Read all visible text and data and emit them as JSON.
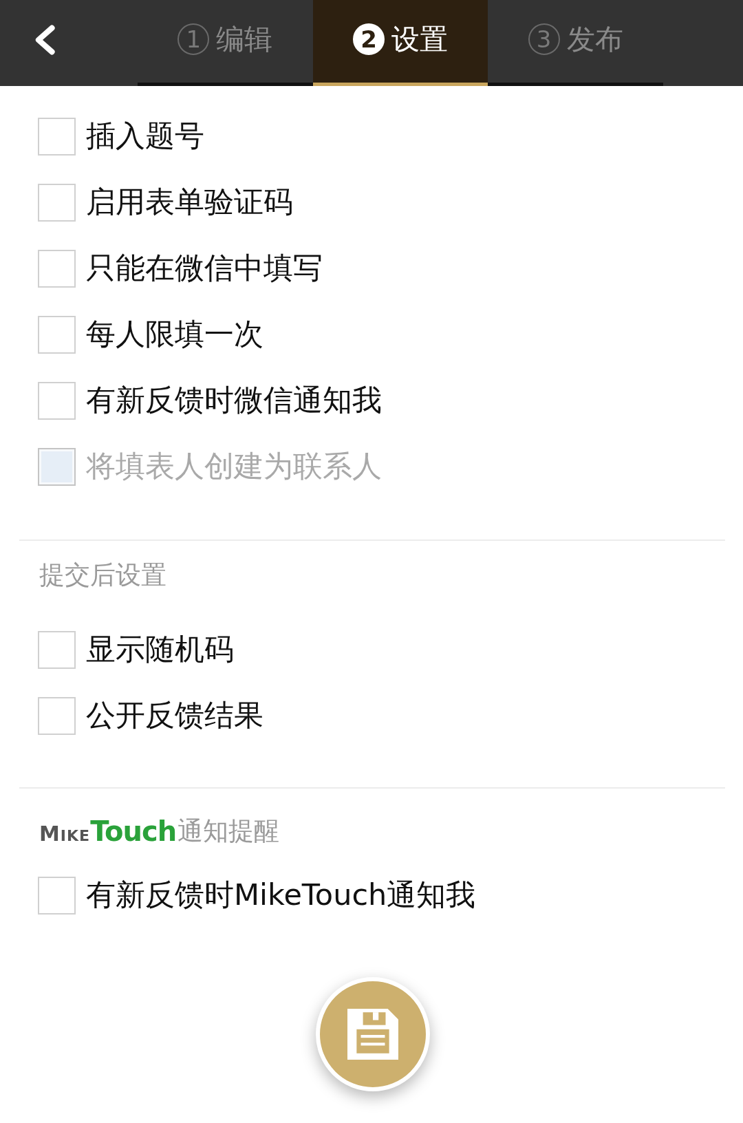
{
  "header": {
    "tabs": [
      {
        "number": "1",
        "label": "编辑",
        "selected": false
      },
      {
        "number": "2",
        "label": "设置",
        "selected": true
      },
      {
        "number": "3",
        "label": "发布",
        "selected": false
      }
    ]
  },
  "options": [
    {
      "label": "插入题号",
      "checked": false,
      "disabled": false
    },
    {
      "label": "启用表单验证码",
      "checked": false,
      "disabled": false
    },
    {
      "label": "只能在微信中填写",
      "checked": false,
      "disabled": false
    },
    {
      "label": "每人限填一次",
      "checked": false,
      "disabled": false
    },
    {
      "label": "有新反馈时微信通知我",
      "checked": false,
      "disabled": false
    },
    {
      "label": "将填表人创建为联系人",
      "checked": false,
      "disabled": true
    }
  ],
  "after_submit": {
    "title": "提交后设置",
    "options": [
      {
        "label": "显示随机码",
        "checked": false,
        "disabled": false
      },
      {
        "label": "公开反馈结果",
        "checked": false,
        "disabled": false
      }
    ]
  },
  "notifications": {
    "logo": {
      "text_1": "MIKE",
      "text_2": "Touch"
    },
    "title": "通知提醒",
    "options": [
      {
        "label": "有新反馈时MikeTouch通知我",
        "checked": false,
        "disabled": false
      }
    ]
  }
}
